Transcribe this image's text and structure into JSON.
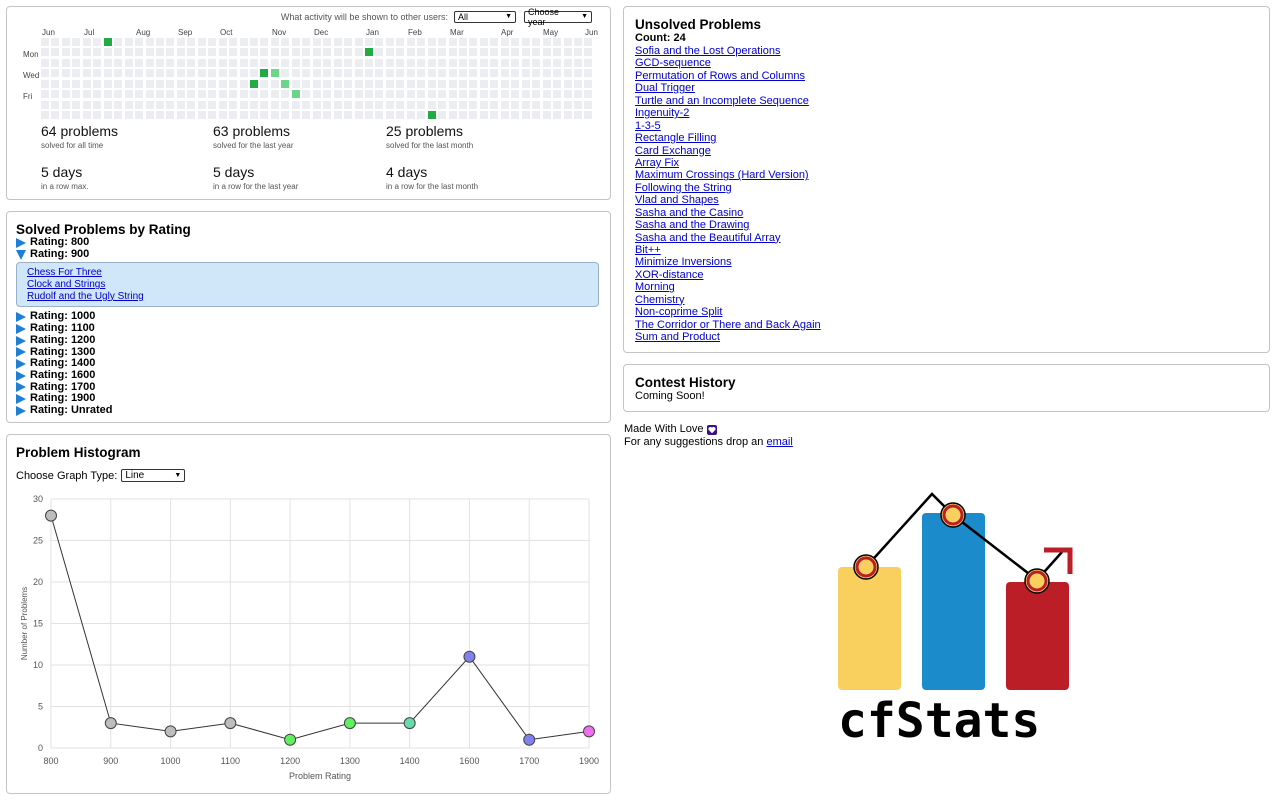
{
  "activity": {
    "visibility_label": "What activity will be shown to other users:",
    "visibility_value": "All",
    "year_value": "Choose year",
    "months": [
      "Jun",
      "Jul",
      "Aug",
      "Sep",
      "Oct",
      "Nov",
      "Dec",
      "Jan",
      "Feb",
      "Mar",
      "Apr",
      "May",
      "Jun"
    ],
    "days": [
      "Mon",
      "Wed",
      "Fri"
    ],
    "stats": [
      {
        "num": "64 problems",
        "sub": "solved for all time"
      },
      {
        "num": "63 problems",
        "sub": "solved for the last year"
      },
      {
        "num": "25 problems",
        "sub": "solved for the last month"
      },
      {
        "num": "5 days",
        "sub": "in a row max."
      },
      {
        "num": "5 days",
        "sub": "in a row for the last year"
      },
      {
        "num": "4 days",
        "sub": "in a row for the last month"
      }
    ],
    "heatmap": {
      "weeks": 53,
      "active_cells": [
        [
          6,
          0,
          2
        ],
        [
          20,
          4,
          2
        ],
        [
          21,
          3,
          2
        ],
        [
          22,
          3,
          1
        ],
        [
          23,
          4,
          1
        ],
        [
          24,
          5,
          1
        ],
        [
          31,
          1,
          2
        ],
        [
          37,
          7,
          2
        ],
        [
          56,
          3,
          1
        ],
        [
          65,
          2,
          2
        ],
        [
          66,
          1,
          2
        ],
        [
          67,
          3,
          1
        ],
        [
          68,
          6,
          1
        ],
        [
          69,
          7,
          2
        ],
        [
          86,
          1,
          2
        ],
        [
          87,
          6,
          2
        ],
        [
          88,
          0,
          2
        ],
        [
          89,
          2,
          2
        ],
        [
          90,
          4,
          1
        ],
        [
          91,
          5,
          1
        ],
        [
          92,
          7,
          2
        ],
        [
          94,
          2,
          2
        ],
        [
          95,
          5,
          1
        ],
        [
          100,
          1,
          2
        ],
        [
          101,
          3,
          2
        ],
        [
          102,
          4,
          2
        ],
        [
          103,
          1,
          1
        ],
        [
          104,
          2,
          2
        ],
        [
          105,
          5,
          1
        ],
        [
          108,
          3,
          2
        ],
        [
          109,
          0,
          2
        ],
        [
          110,
          1,
          2
        ],
        [
          111,
          2,
          2
        ],
        [
          112,
          6,
          2
        ],
        [
          140,
          2,
          2
        ],
        [
          154,
          0,
          3
        ],
        [
          165,
          1,
          1
        ],
        [
          166,
          0,
          1
        ],
        [
          167,
          3,
          1
        ],
        [
          168,
          6,
          1
        ],
        [
          169,
          7,
          1
        ],
        [
          170,
          5,
          1
        ],
        [
          171,
          0,
          1
        ],
        [
          172,
          2,
          1
        ],
        [
          173,
          1,
          1
        ],
        [
          174,
          7,
          1
        ],
        [
          175,
          2,
          1
        ],
        [
          176,
          5,
          1
        ],
        [
          177,
          1,
          1
        ],
        [
          178,
          0,
          1
        ],
        [
          179,
          4,
          1
        ],
        [
          180,
          1,
          2
        ],
        [
          181,
          6,
          2
        ],
        [
          182,
          3,
          1
        ],
        [
          183,
          0,
          1
        ],
        [
          184,
          7,
          1
        ],
        [
          186,
          5,
          1
        ],
        [
          187,
          4,
          1
        ],
        [
          188,
          7,
          1
        ],
        [
          189,
          6,
          3
        ],
        [
          190,
          2,
          2
        ],
        [
          191,
          1,
          1
        ]
      ]
    }
  },
  "rating": {
    "title": "Solved Problems by Rating",
    "rows_before": [
      "Rating: 800"
    ],
    "expanded": "Rating: 900",
    "expanded_items": [
      "Chess For Three",
      "Clock and Strings",
      "Rudolf and the Ugly String"
    ],
    "rows_after": [
      "Rating: 1000",
      "Rating: 1100",
      "Rating: 1200",
      "Rating: 1300",
      "Rating: 1400",
      "Rating: 1600",
      "Rating: 1700",
      "Rating: 1900",
      "Rating: Unrated"
    ]
  },
  "histogram": {
    "title": "Problem Histogram",
    "graph_type_label": "Choose Graph Type:",
    "graph_type_value": "Line"
  },
  "chart_data": {
    "type": "line",
    "x": [
      800,
      900,
      1000,
      1100,
      1200,
      1300,
      1400,
      1600,
      1700,
      1900
    ],
    "values": [
      28,
      3,
      2,
      3,
      1,
      3,
      3,
      11,
      1,
      2
    ],
    "point_colors": [
      "#bdbdbd",
      "#bdbdbd",
      "#bdbdbd",
      "#bdbdbd",
      "#5ef05e",
      "#5ef05e",
      "#66dcaa",
      "#8080f0",
      "#8080f0",
      "#f06ef0"
    ],
    "xlabel": "Problem Rating",
    "ylabel": "Number of Problems",
    "ylim": [
      0,
      30
    ],
    "yticks": [
      0,
      5,
      10,
      15,
      20,
      25,
      30
    ],
    "grid": true
  },
  "unsolved": {
    "title": "Unsolved Problems",
    "count": "Count: 24",
    "items": [
      "Sofia and the Lost Operations",
      "GCD-sequence",
      "Permutation of Rows and Columns",
      "Dual Trigger",
      "Turtle and an Incomplete Sequence",
      "Ingenuity-2",
      "1-3-5",
      "Rectangle Filling",
      "Card Exchange",
      "Array Fix",
      "Maximum Crossings (Hard Version)",
      "Following the String",
      "Vlad and Shapes",
      "Sasha and the Casino",
      "Sasha and the Drawing",
      "Sasha and the Beautiful Array",
      "Bit++",
      "Minimize Inversions",
      "XOR-distance",
      "Morning",
      "Chemistry",
      "Non-coprime Split",
      "The Corridor or There and Back Again",
      "Sum and Product"
    ]
  },
  "contest": {
    "title": "Contest History",
    "text": "Coming Soon!"
  },
  "footer": {
    "made_with": "Made With Love",
    "suggest": "For any suggestions drop an",
    "email_link": "email"
  },
  "logo": {
    "text": "cfStats",
    "colors": {
      "yellow": "#f9cf5e",
      "blue": "#1b8bcb",
      "red": "#bb1e27"
    }
  }
}
